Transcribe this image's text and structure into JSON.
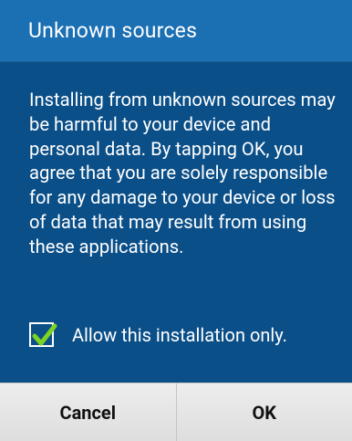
{
  "dialog": {
    "title": "Unknown sources",
    "message": "Installing from unknown sources may be harmful to your device and personal data. By tapping OK, you agree that you are solely responsible for any damage to your device or loss of data that may result from using these applications.",
    "checkbox": {
      "label": "Allow this installation only.",
      "checked": true,
      "check_color": "#7cd321"
    },
    "buttons": {
      "cancel_label": "Cancel",
      "ok_label": "OK"
    }
  },
  "colors": {
    "title_bar": "#1b6fb3",
    "body_background": "#0b4f88",
    "button_bar": "#e6e6e6"
  }
}
